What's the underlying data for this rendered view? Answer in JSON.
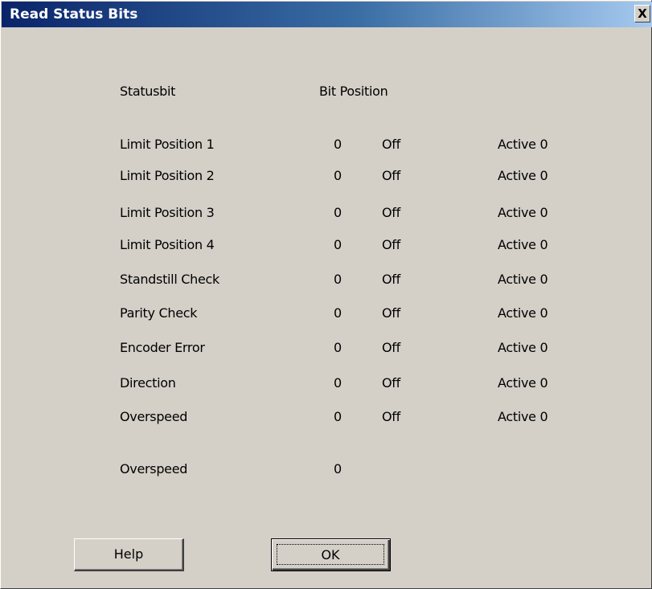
{
  "window": {
    "title": "Read Status Bits",
    "close_glyph": "X"
  },
  "headers": {
    "statusbit": "Statusbit",
    "bit_position": "Bit Position"
  },
  "rows": [
    {
      "label": "Limit Position 1",
      "value": "0",
      "state": "Off",
      "active": "Active 0"
    },
    {
      "label": "Limit Position 2",
      "value": "0",
      "state": "Off",
      "active": "Active 0"
    },
    {
      "label": "Limit Position 3",
      "value": "0",
      "state": "Off",
      "active": "Active 0"
    },
    {
      "label": "Limit Position 4",
      "value": "0",
      "state": "Off",
      "active": "Active 0"
    },
    {
      "label": "Standstill Check",
      "value": "0",
      "state": "Off",
      "active": "Active 0"
    },
    {
      "label": "Parity Check",
      "value": "0",
      "state": "Off",
      "active": "Active 0"
    },
    {
      "label": "Encoder Error",
      "value": "0",
      "state": "Off",
      "active": "Active 0"
    },
    {
      "label": "Direction",
      "value": "0",
      "state": "Off",
      "active": "Active 0"
    },
    {
      "label": "Overspeed",
      "value": "0",
      "state": "Off",
      "active": "Active 0"
    }
  ],
  "summary": {
    "label": "Overspeed",
    "value": "0"
  },
  "buttons": {
    "help": "Help",
    "ok": "OK"
  },
  "colors": {
    "dialog_background": "#d4d0c8",
    "titlebar_start": "#0a246a",
    "titlebar_end": "#a6caf0",
    "title_text": "#ffffff"
  }
}
